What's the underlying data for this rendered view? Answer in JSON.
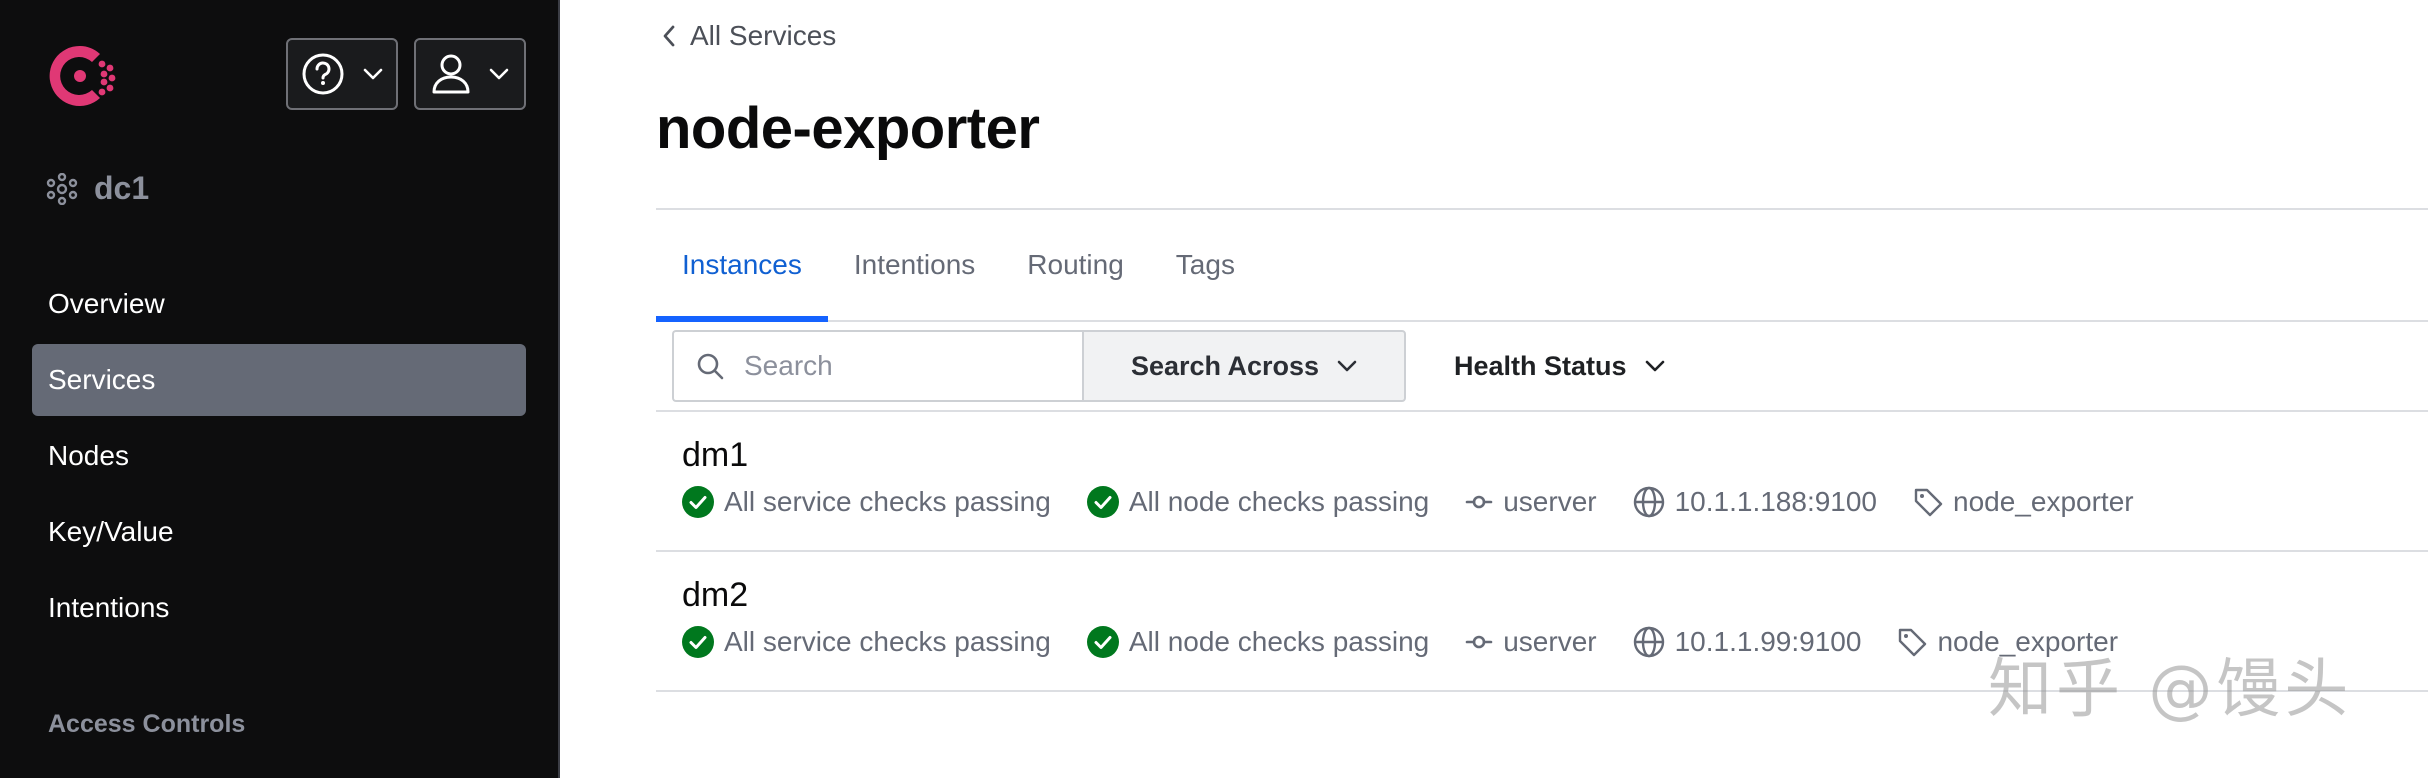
{
  "sidebar": {
    "datacenter": "dc1",
    "items": [
      {
        "label": "Overview",
        "active": false
      },
      {
        "label": "Services",
        "active": true
      },
      {
        "label": "Nodes",
        "active": false
      },
      {
        "label": "Key/Value",
        "active": false
      },
      {
        "label": "Intentions",
        "active": false
      }
    ],
    "section_label": "Access Controls"
  },
  "breadcrumb": {
    "label": "All Services"
  },
  "page": {
    "title": "node-exporter"
  },
  "tabs": [
    {
      "label": "Instances",
      "active": true
    },
    {
      "label": "Intentions",
      "active": false
    },
    {
      "label": "Routing",
      "active": false
    },
    {
      "label": "Tags",
      "active": false
    }
  ],
  "toolbar": {
    "search_placeholder": "Search",
    "search_across_label": "Search Across",
    "health_status_label": "Health Status"
  },
  "instances": [
    {
      "name": "dm1",
      "service_checks": "All service checks passing",
      "node_checks": "All node checks passing",
      "node": "userver",
      "address": "10.1.1.188:9100",
      "tag": "node_exporter"
    },
    {
      "name": "dm2",
      "service_checks": "All service checks passing",
      "node_checks": "All node checks passing",
      "node": "userver",
      "address": "10.1.1.99:9100",
      "tag": "node_exporter"
    }
  ],
  "watermark": "知乎 @馒头",
  "colors": {
    "brand": "#e03875",
    "accent": "#1563ff",
    "passing": "#00781e",
    "sidebar_bg": "#0d0d0e",
    "sidebar_active": "#656a76"
  }
}
